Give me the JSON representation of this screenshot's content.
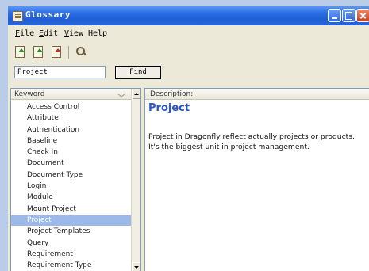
{
  "window": {
    "title": "Glossary"
  },
  "menu": [
    {
      "prefix": "",
      "underline": "F",
      "rest": "ile"
    },
    {
      "prefix": "",
      "underline": "E",
      "rest": "dit"
    },
    {
      "prefix": "",
      "underline": "V",
      "rest": "iew"
    },
    {
      "prefix": "",
      "underline": "",
      "rest": "Help"
    }
  ],
  "toolbar": {
    "icons": [
      "import-icon",
      "export-icon",
      "delete-icon",
      "find-icon"
    ]
  },
  "search": {
    "value": "Project",
    "button_label": "Find"
  },
  "keyword_list": {
    "header": "Keyword",
    "items": [
      "Access Control",
      "Attribute",
      "Authentication",
      "Baseline",
      "Check In",
      "Document",
      "Document Type",
      "Login",
      "Module",
      "Mount Project",
      "Project",
      "Project Templates",
      "Query",
      "Requirement",
      "Requirement Type"
    ],
    "selected": "Project"
  },
  "description": {
    "header": "Description:",
    "title": "Project",
    "line1": "Project in Dragonfly reflect actually projects or products.",
    "line2": "It's the biggest unit in project management."
  },
  "colors": {
    "titlebar": "#2b6ee6",
    "selection": "#9db9e9",
    "desc_title": "#2d55c6"
  }
}
